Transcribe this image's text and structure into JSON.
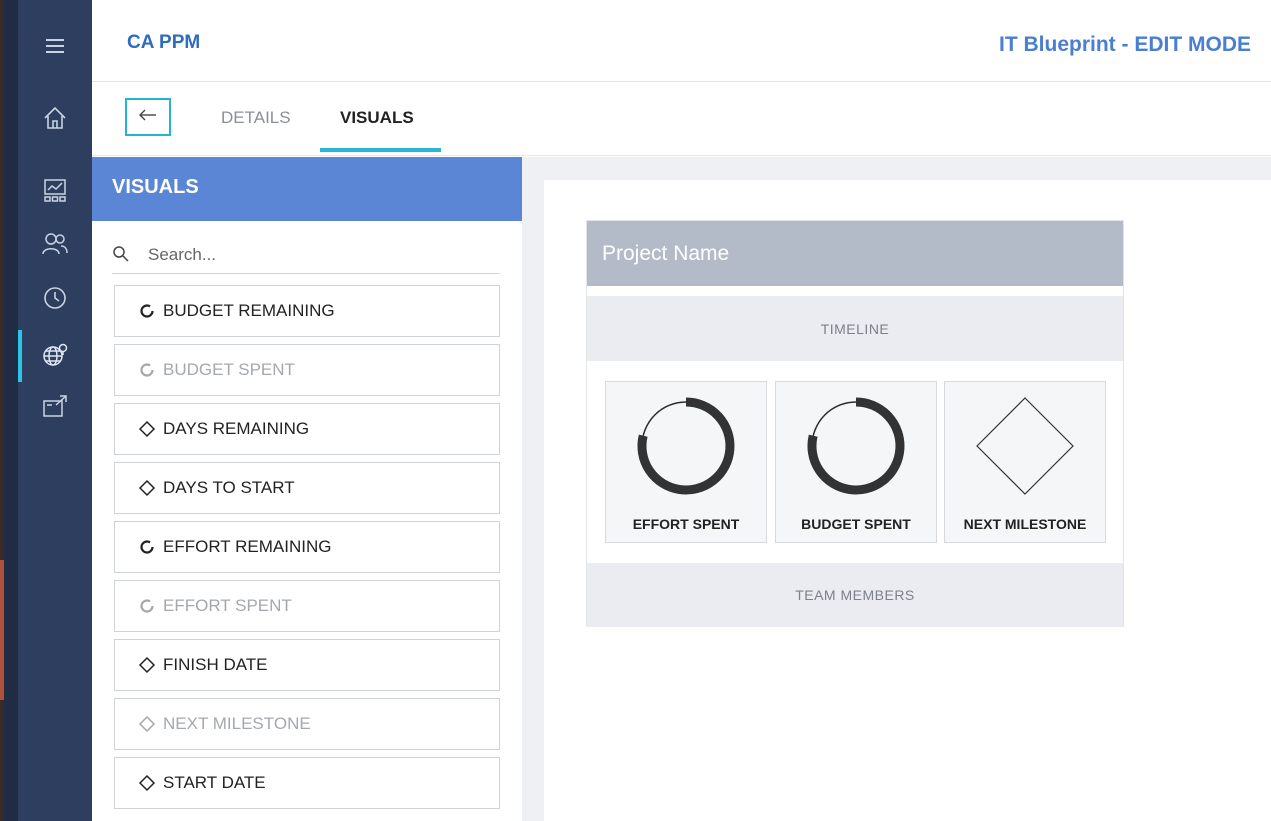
{
  "header": {
    "brand": "CA PPM",
    "title": "IT Blueprint - EDIT MODE"
  },
  "nav_rail": {
    "items": [
      "menu-icon",
      "home-icon",
      "dashboard-icon",
      "team-icon",
      "clock-icon",
      "globe-icon",
      "export-icon"
    ],
    "active": "globe-icon"
  },
  "tabs": {
    "back_icon": "arrow-left-icon",
    "items": [
      {
        "label": "DETAILS",
        "active": false
      },
      {
        "label": "VISUALS",
        "active": true
      }
    ]
  },
  "sidebar": {
    "title": "VISUALS",
    "search": {
      "placeholder": "Search...",
      "value": ""
    },
    "items": [
      {
        "label": "BUDGET REMAINING",
        "icon": "ring-icon",
        "dimmed": false
      },
      {
        "label": "BUDGET SPENT",
        "icon": "ring-icon",
        "dimmed": true
      },
      {
        "label": "DAYS REMAINING",
        "icon": "diamond-icon",
        "dimmed": false
      },
      {
        "label": "DAYS TO START",
        "icon": "diamond-icon",
        "dimmed": false
      },
      {
        "label": "EFFORT REMAINING",
        "icon": "ring-icon",
        "dimmed": false
      },
      {
        "label": "EFFORT SPENT",
        "icon": "ring-icon",
        "dimmed": true
      },
      {
        "label": "FINISH DATE",
        "icon": "diamond-icon",
        "dimmed": false
      },
      {
        "label": "NEXT MILESTONE",
        "icon": "diamond-icon",
        "dimmed": true
      },
      {
        "label": "START DATE",
        "icon": "diamond-icon",
        "dimmed": false
      }
    ]
  },
  "preview": {
    "card_title": "Project Name",
    "timeline_label": "TIMELINE",
    "team_label": "TEAM MEMBERS",
    "tiles": [
      {
        "label": "EFFORT SPENT",
        "icon": "ring-gauge-icon"
      },
      {
        "label": "BUDGET SPENT",
        "icon": "ring-gauge-icon"
      },
      {
        "label": "NEXT MILESTONE",
        "icon": "diamond-icon"
      }
    ]
  },
  "colors": {
    "rail": "#2e3e5f",
    "accent": "#2ab5d5",
    "panel_header": "#5b86d6",
    "brand": "#2f6bbf",
    "card_header": "#b3bbc9"
  }
}
